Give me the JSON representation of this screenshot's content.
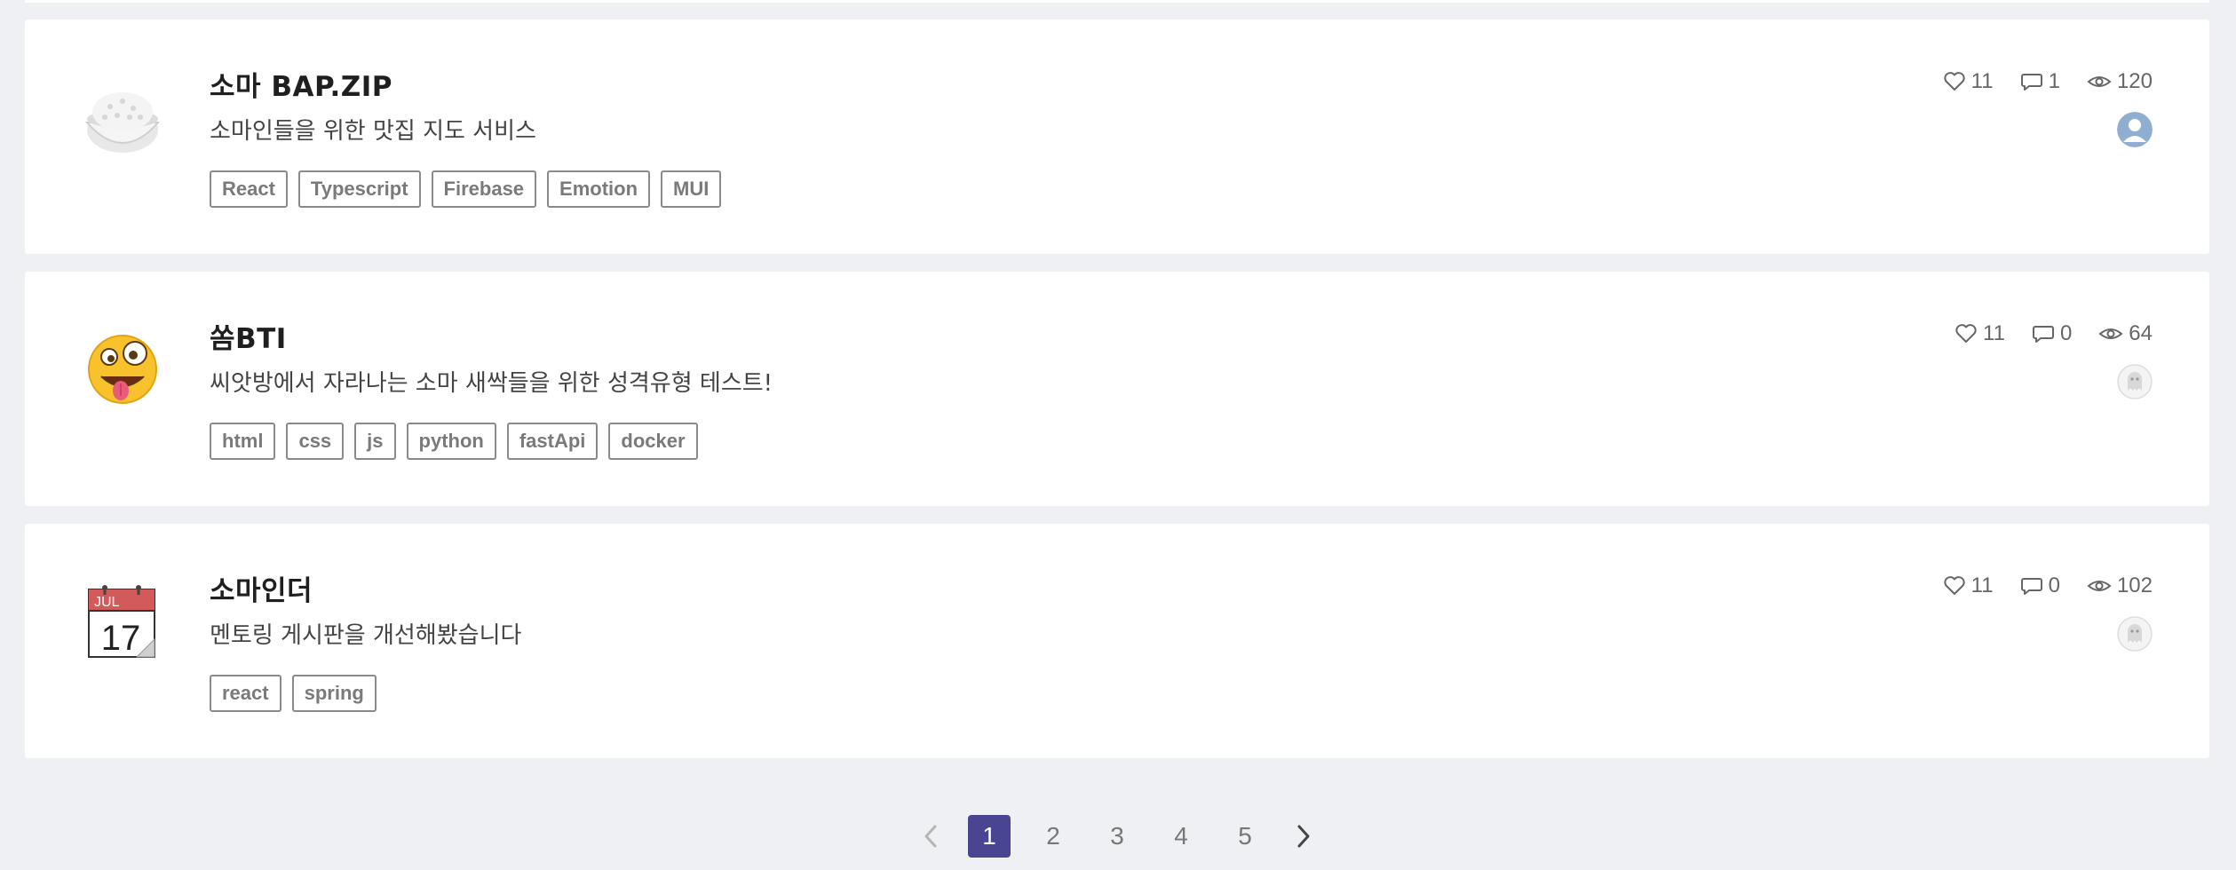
{
  "colors": {
    "background": "#eef0f3",
    "card": "#ffffff",
    "active_page": "#4a4593"
  },
  "projects": [
    {
      "thumbnail_icon": "rice-bowl-icon",
      "title": "소마 BAP.ZIP",
      "description": "소마인들을 위한 맛집 지도 서비스",
      "tags": [
        "React",
        "Typescript",
        "Firebase",
        "Emotion",
        "MUI"
      ],
      "likes": "11",
      "comments": "1",
      "views": "120",
      "author_avatar": "default-user-avatar"
    },
    {
      "thumbnail_icon": "zany-face-icon",
      "title": "쏨BTI",
      "description": "씨앗방에서 자라나는 소마 새싹들을 위한 성격유형 테스트!",
      "tags": [
        "html",
        "css",
        "js",
        "python",
        "fastApi",
        "docker"
      ],
      "likes": "11",
      "comments": "0",
      "views": "64",
      "author_avatar": "ghost-user-avatar"
    },
    {
      "thumbnail_icon": "calendar-icon",
      "calendar_month": "JUL",
      "calendar_day": "17",
      "title": "소마인더",
      "description": "멘토링 게시판을 개선해봤습니다",
      "tags": [
        "react",
        "spring"
      ],
      "likes": "11",
      "comments": "0",
      "views": "102",
      "author_avatar": "ghost-user-avatar"
    }
  ],
  "pagination": {
    "pages": [
      "1",
      "2",
      "3",
      "4",
      "5"
    ],
    "current": "1"
  }
}
